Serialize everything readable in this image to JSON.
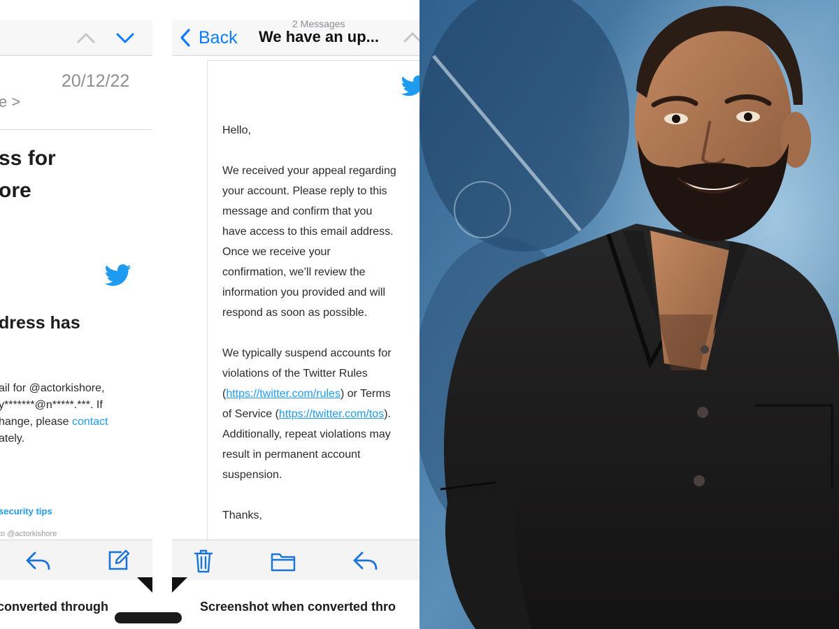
{
  "mail_left": {
    "date": "20/12/22",
    "sender_fragment": "e >",
    "subject": [
      "ss for",
      "ore"
    ],
    "headline": "dress has",
    "body_lines": [
      "ail for @actorkishore,",
      "y*******@n*****.***. If",
      "hange, please "
    ],
    "contact_link": "contact",
    "body_last_line": "ately.",
    "security_tips": "security tips",
    "sent_to": "to @actorkishore",
    "caption": "converted through"
  },
  "mail_right": {
    "back_label": "Back",
    "message_count": "2 Messages",
    "title": "We have an up...",
    "greeting": "Hello,",
    "para1": [
      "We received your appeal regarding",
      "your account. Please reply to this",
      "message and confirm that you",
      "have access to this email address.",
      "Once we receive your",
      "confirmation, we’ll review the",
      "information you provided and will",
      "respond as soon as possible."
    ],
    "para2_line1": "We typically suspend accounts for",
    "para2_line2": "violations of the Twitter Rules",
    "rules_open": "(",
    "rules_link": "https://twitter.com/rules",
    "rules_after": ") or Terms",
    "tos_before": "of Service (",
    "tos_link": "https://twitter.com/tos",
    "tos_after": ").",
    "para2_line5": "Additionally, repeat violations may",
    "para2_line6": "result in permanent account",
    "para2_line7": "suspension.",
    "signoff": "Thanks,",
    "caption": "Screenshot when converted thro"
  },
  "colors": {
    "ios_blue": "#0a7cff",
    "twitter_blue": "#1d9bf0",
    "toolbar_icon": "#1a73d9",
    "backdrop_blue": "#3d6f98",
    "shirt": "#1b1a1a",
    "skin": "#b07a55"
  },
  "icons": {
    "chevron_up": "chevron-up-icon",
    "chevron_down": "chevron-down-icon",
    "twitter": "twitter-bird-icon",
    "reply": "reply-icon",
    "compose": "compose-icon",
    "trash": "trash-icon",
    "folder": "folder-icon"
  }
}
